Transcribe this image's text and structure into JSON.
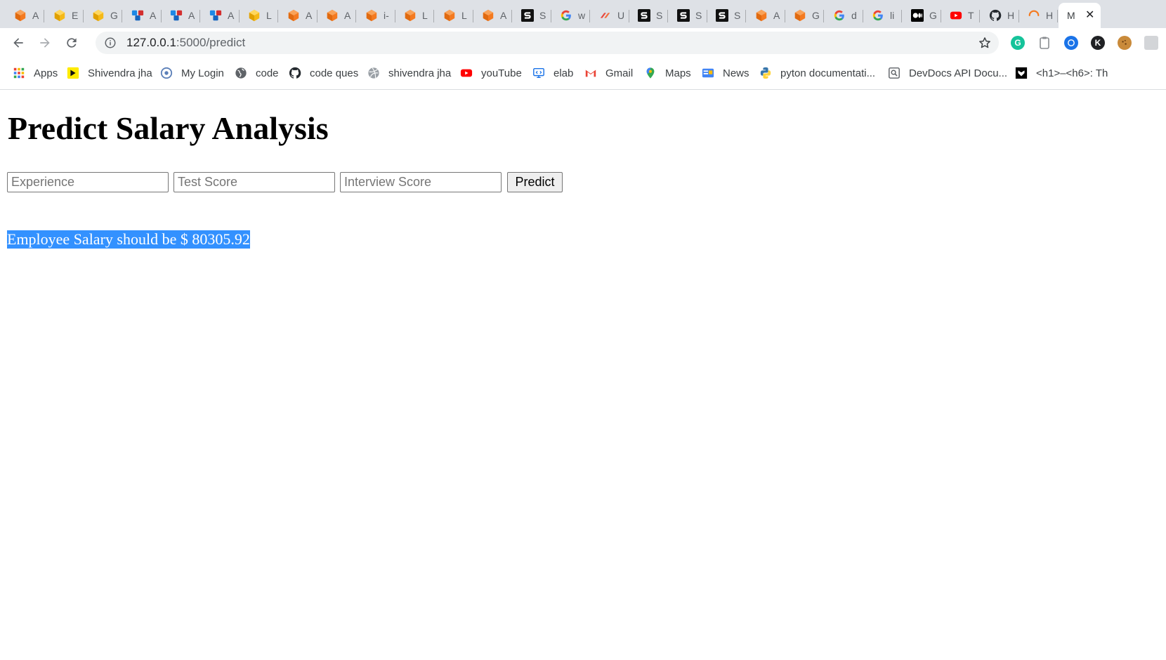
{
  "browser": {
    "tabs": [
      {
        "icon": "orange-cube-icon",
        "title": "A"
      },
      {
        "icon": "yellow-cube-icon",
        "title": "E"
      },
      {
        "icon": "yellow-cube-icon",
        "title": "G"
      },
      {
        "icon": "blue-cubes-icon",
        "title": "A"
      },
      {
        "icon": "blue-cubes-icon",
        "title": "A"
      },
      {
        "icon": "blue-cubes-icon",
        "title": "A"
      },
      {
        "icon": "yellow-cube-icon",
        "title": "L"
      },
      {
        "icon": "orange-cube-icon",
        "title": "A"
      },
      {
        "icon": "orange-cube-icon",
        "title": "A"
      },
      {
        "icon": "orange-cube-icon",
        "title": "i-"
      },
      {
        "icon": "orange-cube-icon",
        "title": "L"
      },
      {
        "icon": "orange-cube-icon",
        "title": "L"
      },
      {
        "icon": "orange-cube-icon",
        "title": "A"
      },
      {
        "icon": "s-logo-icon",
        "title": "S"
      },
      {
        "icon": "google-icon",
        "title": "w"
      },
      {
        "icon": "udemy-icon",
        "title": "U"
      },
      {
        "icon": "s-logo-icon",
        "title": "S"
      },
      {
        "icon": "s-logo-icon",
        "title": "S"
      },
      {
        "icon": "s-logo-icon",
        "title": "S"
      },
      {
        "icon": "orange-cube-icon",
        "title": "A"
      },
      {
        "icon": "orange-cube-icon",
        "title": "G"
      },
      {
        "icon": "google-icon",
        "title": "d"
      },
      {
        "icon": "google-icon",
        "title": "li"
      },
      {
        "icon": "medium-icon",
        "title": "G"
      },
      {
        "icon": "youtube-icon",
        "title": "T"
      },
      {
        "icon": "github-icon",
        "title": "H"
      },
      {
        "icon": "loading-spinner-icon",
        "title": "H"
      }
    ],
    "active_tab": {
      "title": "M",
      "close_label": "✕"
    },
    "url": {
      "host": "127.0.0.1",
      "path": ":5000/predict"
    },
    "bookmarks": [
      {
        "icon": "apps-grid-icon",
        "label": "Apps"
      },
      {
        "icon": "yellow-bookmark-icon",
        "label": "Shivendra jha"
      },
      {
        "icon": "login-icon",
        "label": "My Login"
      },
      {
        "icon": "globe-icon",
        "label": "code"
      },
      {
        "icon": "github-icon",
        "label": "code ques"
      },
      {
        "icon": "dribbble-icon",
        "label": "shivendra jha"
      },
      {
        "icon": "youtube-icon",
        "label": "youTube"
      },
      {
        "icon": "elab-icon",
        "label": "elab"
      },
      {
        "icon": "gmail-icon",
        "label": "Gmail"
      },
      {
        "icon": "maps-pin-icon",
        "label": "Maps"
      },
      {
        "icon": "news-icon",
        "label": "News"
      },
      {
        "icon": "python-icon",
        "label": "pyton documentati..."
      },
      {
        "icon": "devdocs-icon",
        "label": "DevDocs API Docu..."
      },
      {
        "icon": "black-square-icon",
        "label": "<h1>–<h6>: Th"
      }
    ]
  },
  "page": {
    "title": "Predict Salary Analysis",
    "form": {
      "experience_placeholder": "Experience",
      "test_score_placeholder": "Test Score",
      "interview_score_placeholder": "Interview Score",
      "submit_label": "Predict"
    },
    "result_text": "Employee Salary should be $ 80305.92",
    "selection_color": "#3391ff"
  }
}
